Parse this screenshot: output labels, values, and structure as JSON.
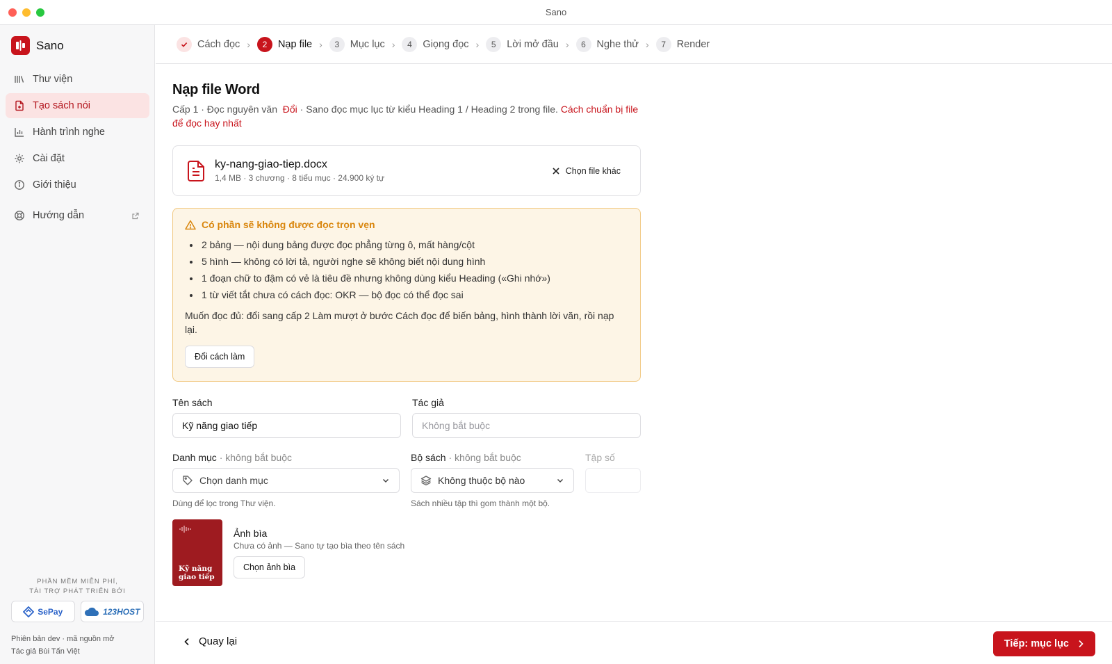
{
  "window": {
    "title": "Sano"
  },
  "brand": {
    "name": "Sano",
    "accent": "#c8141c"
  },
  "sidebar": {
    "items": [
      {
        "label": "Thư viện",
        "icon": "library-icon",
        "active": false
      },
      {
        "label": "Tạo sách nói",
        "icon": "file-plus-icon",
        "active": true
      },
      {
        "label": "Hành trình nghe",
        "icon": "bar-chart-icon",
        "active": false
      },
      {
        "label": "Cài đặt",
        "icon": "gear-icon",
        "active": false
      },
      {
        "label": "Giới thiệu",
        "icon": "info-icon",
        "active": false
      }
    ],
    "guide": {
      "label": "Hướng dẫn",
      "icon": "lifebuoy-icon"
    },
    "sponsor_label_1": "Phần mềm miễn phí,",
    "sponsor_label_2": "tài trợ phát triển bởi",
    "sponsors": [
      "SePay",
      "123HOST"
    ],
    "footer_line_1": "Phiên bản dev · mã nguồn mở",
    "footer_line_2": "Tác giả Bùi Tấn Việt"
  },
  "stepper": {
    "steps": [
      {
        "num": "✓",
        "label": "Cách đọc",
        "state": "done"
      },
      {
        "num": "2",
        "label": "Nạp file",
        "state": "current"
      },
      {
        "num": "3",
        "label": "Mục lục",
        "state": "todo"
      },
      {
        "num": "4",
        "label": "Giọng đọc",
        "state": "todo"
      },
      {
        "num": "5",
        "label": "Lời mở đầu",
        "state": "todo"
      },
      {
        "num": "6",
        "label": "Nghe thử",
        "state": "todo"
      },
      {
        "num": "7",
        "label": "Render",
        "state": "todo"
      }
    ]
  },
  "main": {
    "title": "Nạp file Word",
    "desc_prefix": "Cấp 1 · Đọc nguyên văn",
    "desc_change": "Đổi",
    "desc_middle": "· Sano đọc mục lục từ kiểu Heading 1 / Heading 2 trong file.",
    "desc_link": "Cách chuẩn bị file để đọc hay nhất",
    "file": {
      "name": "ky-nang-giao-tiep.docx",
      "meta": "1,4 MB · 3 chương · 8 tiểu mục · 24.900 ký tự",
      "change_label": "Chọn file khác"
    },
    "warning": {
      "title": "Có phần sẽ không được đọc trọn vẹn",
      "items": [
        "2 bảng — nội dung bảng được đọc phẳng từng ô, mất hàng/cột",
        "5 hình — không có lời tả, người nghe sẽ không biết nội dung hình",
        "1 đoạn chữ to đậm có vẻ là tiêu đề nhưng không dùng kiểu Heading («Ghi nhớ»)",
        "1 từ viết tắt chưa có cách đọc: OKR — bộ đọc có thể đọc sai"
      ],
      "note": "Muốn đọc đủ: đổi sang cấp 2 Làm mượt ở bước Cách đọc để biến bảng, hình thành lời văn, rồi nạp lại.",
      "button": "Đổi cách làm"
    },
    "form": {
      "book_title_label": "Tên sách",
      "book_title_value": "Kỹ năng giao tiếp",
      "author_label": "Tác giả",
      "author_placeholder": "Không bắt buộc",
      "category_label": "Danh mục",
      "category_optional": "· không bắt buộc",
      "category_placeholder": "Chọn danh mục",
      "category_hint": "Dùng để lọc trong Thư viện.",
      "series_label": "Bộ sách",
      "series_optional": "· không bắt buộc",
      "series_value": "Không thuộc bộ nào",
      "series_hint": "Sách nhiều tập thì gom thành một bộ.",
      "volume_label": "Tập số"
    },
    "cover": {
      "title_line_1": "Kỹ năng",
      "title_line_2": "giao tiếp",
      "label": "Ảnh bìa",
      "hint": "Chưa có ảnh — Sano tự tạo bìa theo tên sách",
      "button": "Chọn ảnh bìa"
    }
  },
  "bottom": {
    "back_label": "Quay lại",
    "next_label": "Tiếp: mục lục"
  }
}
